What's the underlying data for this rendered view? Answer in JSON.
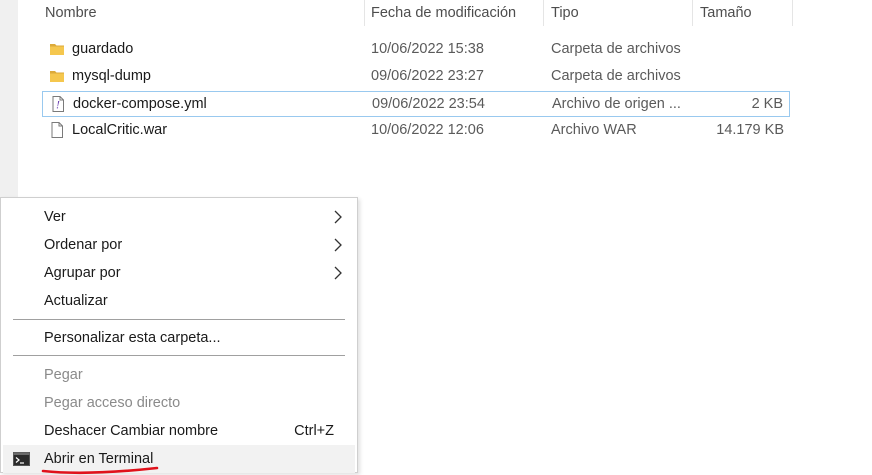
{
  "columns": {
    "name": "Nombre",
    "date": "Fecha de modificación",
    "type": "Tipo",
    "size": "Tamaño"
  },
  "files": [
    {
      "name": "guardado",
      "date": "10/06/2022 15:38",
      "type": "Carpeta de archivos",
      "size": "",
      "icon": "folder-icon"
    },
    {
      "name": "mysql-dump",
      "date": "09/06/2022 23:27",
      "type": "Carpeta de archivos",
      "size": "",
      "icon": "folder-icon"
    },
    {
      "name": "docker-compose.yml",
      "date": "09/06/2022 23:54",
      "type": "Archivo de origen ...",
      "size": "2 KB",
      "icon": "yml-file-icon",
      "selected": true
    },
    {
      "name": "LocalCritic.war",
      "date": "10/06/2022 12:06",
      "type": "Archivo WAR",
      "size": "14.179 KB",
      "icon": "file-icon"
    }
  ],
  "context_menu": {
    "view": "Ver",
    "sort_by": "Ordenar por",
    "group_by": "Agrupar por",
    "refresh": "Actualizar",
    "customize": "Personalizar esta carpeta...",
    "paste": "Pegar",
    "paste_shortcut": "Pegar acceso directo",
    "undo_rename": "Deshacer Cambiar nombre",
    "undo_shortcut": "Ctrl+Z",
    "open_terminal": "Abrir en Terminal"
  },
  "colors": {
    "folder": "#f0c14b",
    "selection_border": "#99c9ef",
    "annotation": "#e0121b"
  }
}
